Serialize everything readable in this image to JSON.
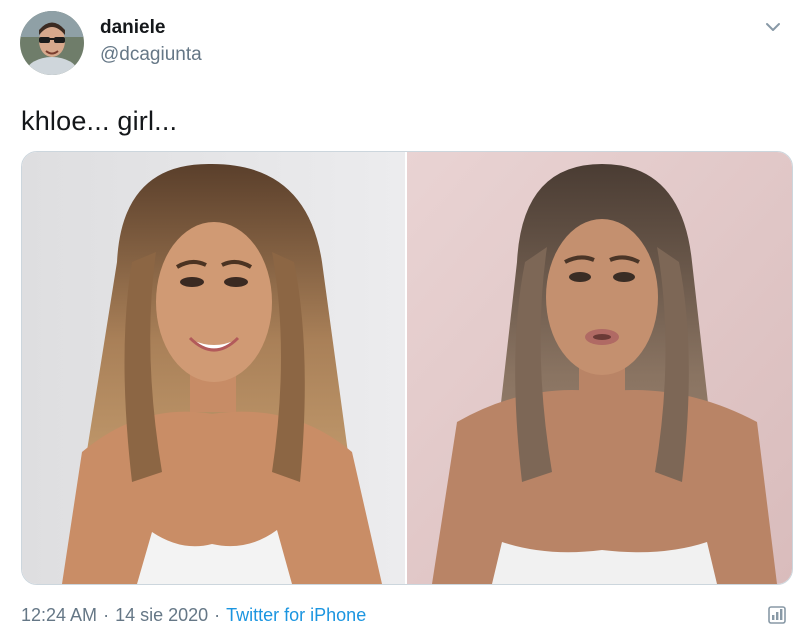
{
  "tweet": {
    "author": {
      "name": "daniele",
      "handle": "@dcagiunta",
      "avatar_icon": "profile-avatar"
    },
    "text": "khloe... girl...",
    "media": [
      {
        "label": "photo-left",
        "background": "#e6e6e8"
      },
      {
        "label": "photo-right",
        "background": "#e2c9ca"
      }
    ],
    "meta": {
      "time": "12:24 AM",
      "separator": "·",
      "date": "14 sie 2020",
      "source": "Twitter for iPhone"
    },
    "icons": {
      "menu": "chevron-down-icon",
      "analytics": "analytics-icon"
    }
  },
  "colors": {
    "text_primary": "#14171a",
    "text_secondary": "#657786",
    "link": "#1b95e0",
    "border": "#ccd6dd"
  }
}
